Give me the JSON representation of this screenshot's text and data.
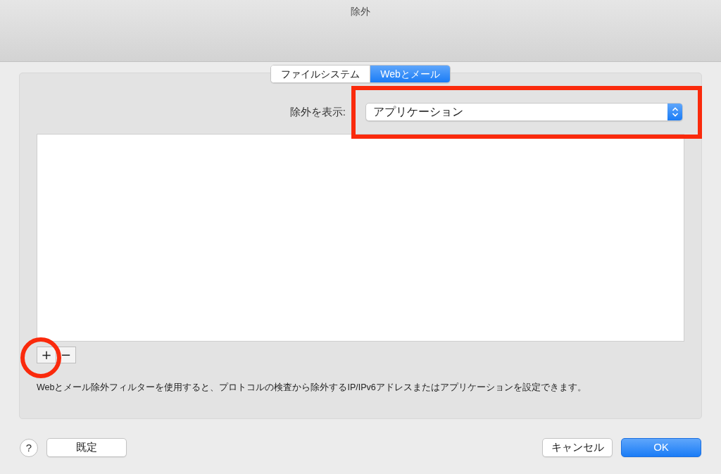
{
  "window": {
    "title": "除外"
  },
  "tabs": [
    {
      "label": "ファイルシステム",
      "selected": false
    },
    {
      "label": "Webとメール",
      "selected": true
    }
  ],
  "filter": {
    "label": "除外を表示:",
    "value": "アプリケーション"
  },
  "list_buttons": [
    "+",
    "−"
  ],
  "description": "Webとメール除外フィルターを使用すると、プロトコルの検査から除外するIP/IPv6アドレスまたはアプリケーションを設定できます。",
  "help": "?",
  "left_buttons": [
    {
      "label": "既定"
    }
  ],
  "right_buttons": [
    {
      "label": "キャンセル",
      "kind": "plain"
    },
    {
      "label": "OK",
      "kind": "primary"
    }
  ]
}
